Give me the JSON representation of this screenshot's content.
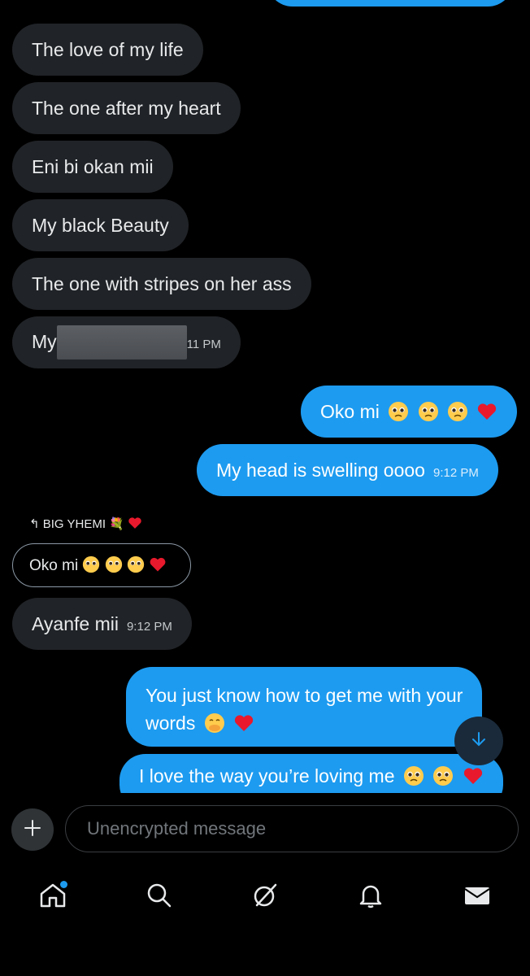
{
  "messages": {
    "in1": "The love of my life",
    "in2": "The one after my heart",
    "in3": "Eni bi okan mii",
    "in4": "My black Beauty",
    "in5": "The one with stripes on her ass",
    "in6": "My",
    "in6_time": "11 PM",
    "out1": "Oko mi",
    "out2": "My head is swelling oooo",
    "out2_time": "9:12 PM",
    "reply_to_name": "BIG YHEMI",
    "reply_quote": "Oko mi",
    "in7": "Ayanfe mii",
    "in7_time": "9:12 PM",
    "out3_line1": "You just know how to get me with your",
    "out3_line2": "words",
    "out4": "I love the way you’re loving me"
  },
  "composer": {
    "placeholder": "Unencrypted message"
  },
  "nav": [
    "home-icon",
    "search-icon",
    "grok-icon",
    "notifications-icon",
    "messages-icon"
  ],
  "colors": {
    "accent": "#1d9bf0",
    "incoming": "#202327",
    "background": "#000000"
  }
}
